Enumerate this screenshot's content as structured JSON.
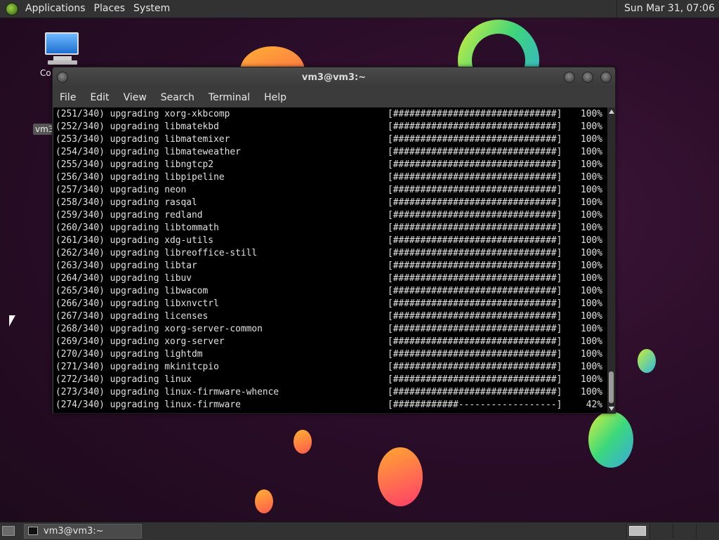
{
  "top_panel": {
    "menus": [
      "Applications",
      "Places",
      "System"
    ],
    "clock": "Sun Mar 31, 07:06"
  },
  "desktop": {
    "computer_label": "Co",
    "home_label": "vm3"
  },
  "window": {
    "title": "vm3@vm3:~",
    "menus": [
      "File",
      "Edit",
      "View",
      "Search",
      "Terminal",
      "Help"
    ]
  },
  "terminal": {
    "lines": [
      {
        "idx": "(251/340) upgrading xorg-xkbcomp",
        "bar": "[##############################]",
        "pct": "100%"
      },
      {
        "idx": "(252/340) upgrading libmatekbd",
        "bar": "[##############################]",
        "pct": "100%"
      },
      {
        "idx": "(253/340) upgrading libmatemixer",
        "bar": "[##############################]",
        "pct": "100%"
      },
      {
        "idx": "(254/340) upgrading libmateweather",
        "bar": "[##############################]",
        "pct": "100%"
      },
      {
        "idx": "(255/340) upgrading libngtcp2",
        "bar": "[##############################]",
        "pct": "100%"
      },
      {
        "idx": "(256/340) upgrading libpipeline",
        "bar": "[##############################]",
        "pct": "100%"
      },
      {
        "idx": "(257/340) upgrading neon",
        "bar": "[##############################]",
        "pct": "100%"
      },
      {
        "idx": "(258/340) upgrading rasqal",
        "bar": "[##############################]",
        "pct": "100%"
      },
      {
        "idx": "(259/340) upgrading redland",
        "bar": "[##############################]",
        "pct": "100%"
      },
      {
        "idx": "(260/340) upgrading libtommath",
        "bar": "[##############################]",
        "pct": "100%"
      },
      {
        "idx": "(261/340) upgrading xdg-utils",
        "bar": "[##############################]",
        "pct": "100%"
      },
      {
        "idx": "(262/340) upgrading libreoffice-still",
        "bar": "[##############################]",
        "pct": "100%"
      },
      {
        "idx": "(263/340) upgrading libtar",
        "bar": "[##############################]",
        "pct": "100%"
      },
      {
        "idx": "(264/340) upgrading libuv",
        "bar": "[##############################]",
        "pct": "100%"
      },
      {
        "idx": "(265/340) upgrading libwacom",
        "bar": "[##############################]",
        "pct": "100%"
      },
      {
        "idx": "(266/340) upgrading libxnvctrl",
        "bar": "[##############################]",
        "pct": "100%"
      },
      {
        "idx": "(267/340) upgrading licenses",
        "bar": "[##############################]",
        "pct": "100%"
      },
      {
        "idx": "(268/340) upgrading xorg-server-common",
        "bar": "[##############################]",
        "pct": "100%"
      },
      {
        "idx": "(269/340) upgrading xorg-server",
        "bar": "[##############################]",
        "pct": "100%"
      },
      {
        "idx": "(270/340) upgrading lightdm",
        "bar": "[##############################]",
        "pct": "100%"
      },
      {
        "idx": "(271/340) upgrading mkinitcpio",
        "bar": "[##############################]",
        "pct": "100%"
      },
      {
        "idx": "(272/340) upgrading linux",
        "bar": "[##############################]",
        "pct": "100%"
      },
      {
        "idx": "(273/340) upgrading linux-firmware-whence",
        "bar": "[##############################]",
        "pct": "100%"
      },
      {
        "idx": "(274/340) upgrading linux-firmware",
        "bar": "[############------------------]",
        "pct": "42%"
      }
    ]
  },
  "taskbar": {
    "task_label": "vm3@vm3:~"
  },
  "colors": {
    "terminal_bg": "#000000",
    "terminal_fg": "#e0e0e0",
    "panel_bg": "#323232",
    "desktop_bg": "#2b0d29"
  }
}
